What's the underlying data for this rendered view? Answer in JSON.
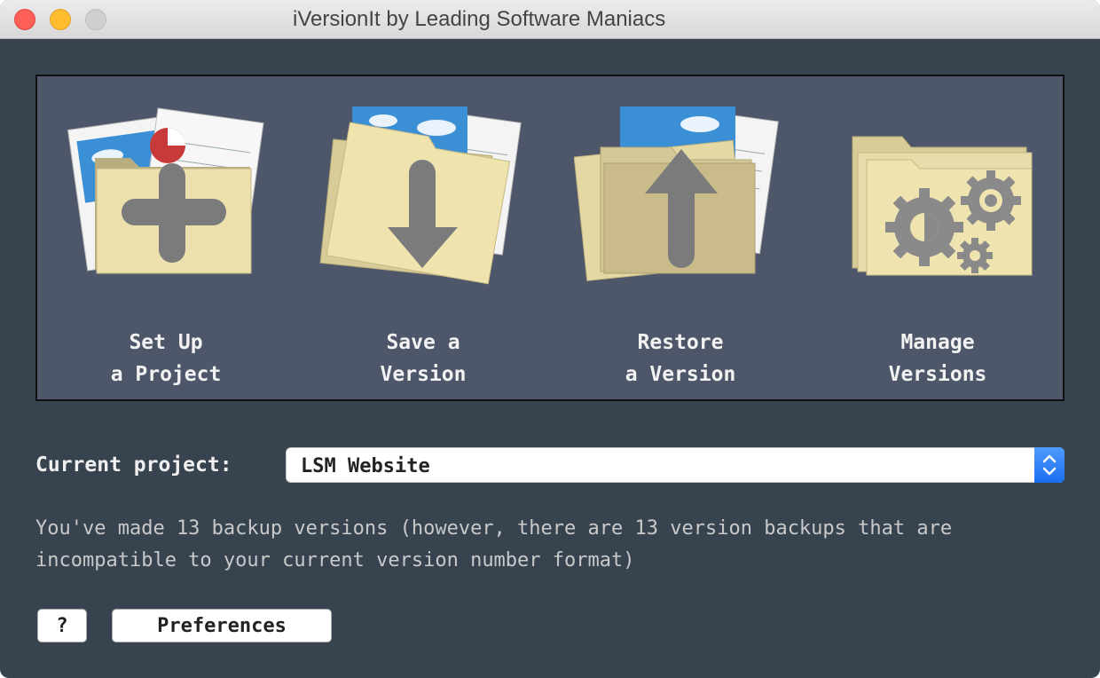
{
  "window": {
    "title": "iVersionIt by Leading Software Maniacs"
  },
  "actions": [
    {
      "line1": "Set Up",
      "line2": "a Project",
      "icon": "folder-plus-icon"
    },
    {
      "line1": "Save a",
      "line2": "Version",
      "icon": "folder-down-arrow-icon"
    },
    {
      "line1": "Restore",
      "line2": "a Version",
      "icon": "folder-up-arrow-icon"
    },
    {
      "line1": "Manage",
      "line2": "Versions",
      "icon": "folder-gears-icon"
    }
  ],
  "project": {
    "label": "Current project:",
    "selected": "LSM Website"
  },
  "info": {
    "line1": "You've made 13 backup versions (however, there are 13 version backups that are",
    "line2": "incompatible to your current version number format)"
  },
  "buttons": {
    "help": "?",
    "preferences": "Preferences"
  },
  "colors": {
    "background": "#384350",
    "panel": "#4e5769",
    "folder": "#e8dca8",
    "accent": "#1a6ef0"
  }
}
